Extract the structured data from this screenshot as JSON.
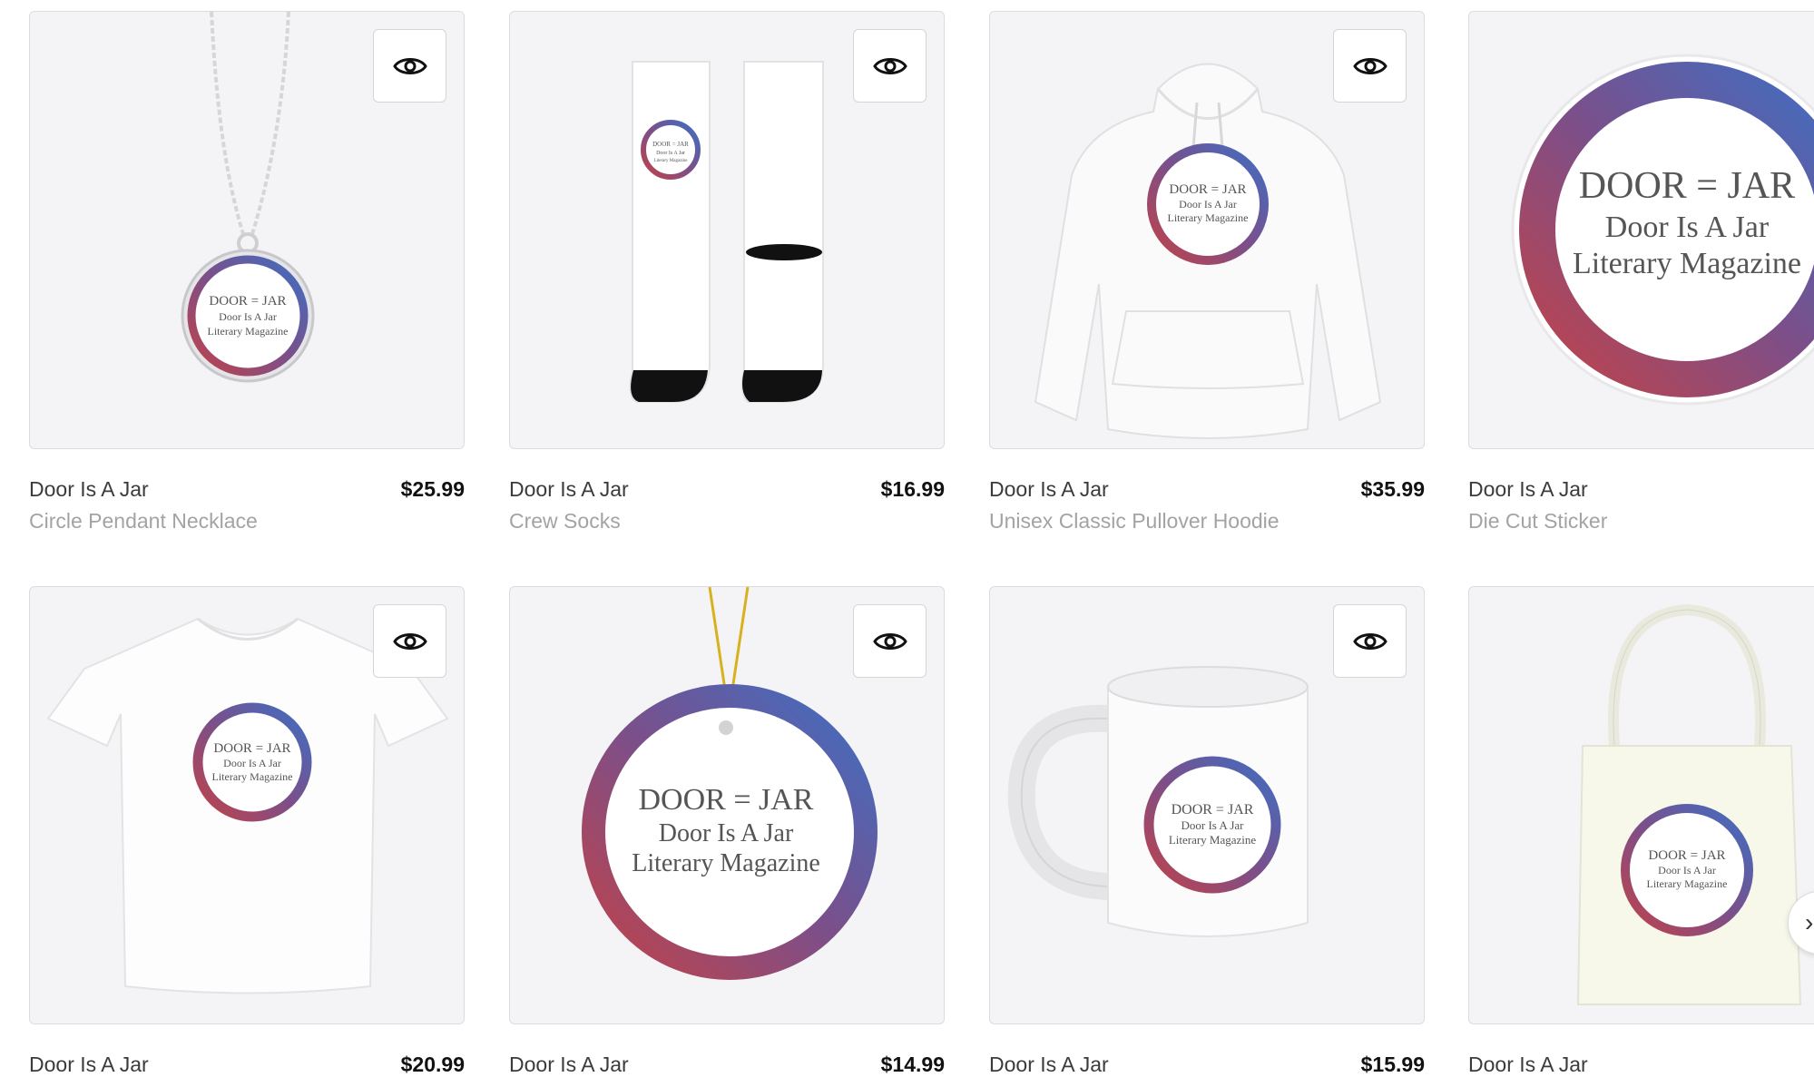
{
  "products": [
    {
      "title": "Door Is A Jar",
      "price": "$25.99",
      "subtitle": "Circle Pendant Necklace"
    },
    {
      "title": "Door Is A Jar",
      "price": "$16.99",
      "subtitle": "Crew Socks"
    },
    {
      "title": "Door Is A Jar",
      "price": "$35.99",
      "subtitle": "Unisex Classic Pullover Hoodie"
    },
    {
      "title": "Door Is A Jar",
      "price": "",
      "subtitle": "Die Cut Sticker"
    },
    {
      "title": "Door Is A Jar",
      "price": "$20.99",
      "subtitle": ""
    },
    {
      "title": "Door Is A Jar",
      "price": "$14.99",
      "subtitle": ""
    },
    {
      "title": "Door Is A Jar",
      "price": "$15.99",
      "subtitle": ""
    },
    {
      "title": "Door Is A Jar",
      "price": "",
      "subtitle": ""
    }
  ],
  "logo": {
    "line1": "DOOR = JAR",
    "line2": "Door Is A Jar",
    "line3": "Literary Magazine",
    "gradient_start": "#c0434a",
    "gradient_end": "#3e6fc4"
  },
  "icons": {
    "quick_view": "eye-icon",
    "next": "chevron-right-icon"
  },
  "next_arrow_glyph": "›"
}
